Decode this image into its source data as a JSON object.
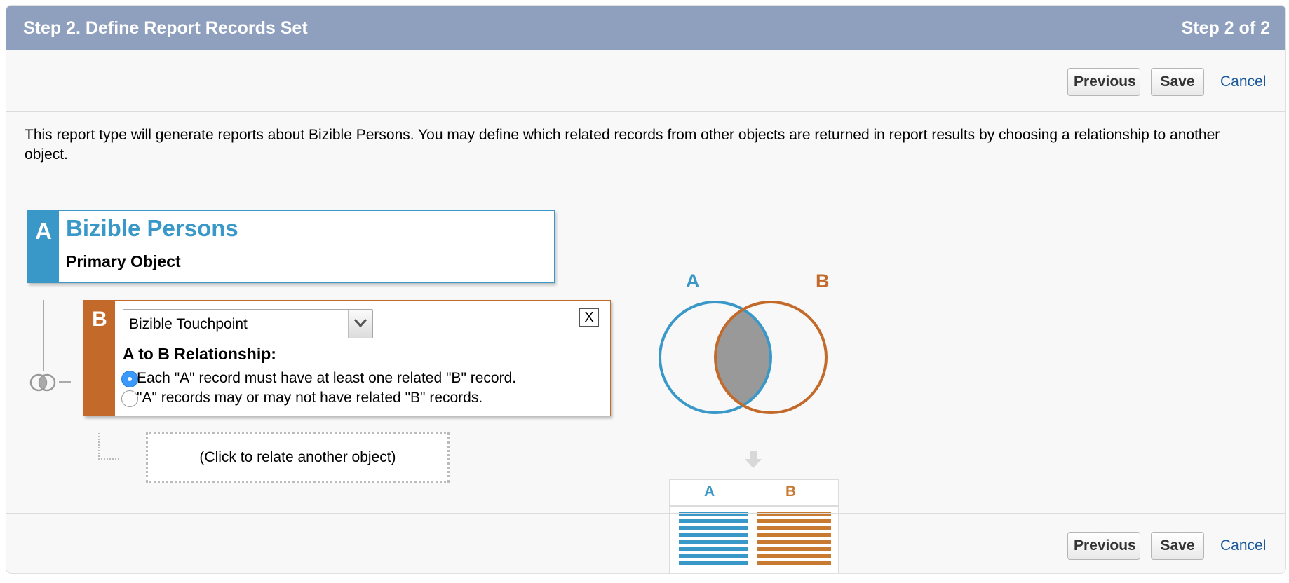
{
  "header": {
    "title": "Step 2. Define Report Records Set",
    "step": "Step 2 of 2"
  },
  "buttons": {
    "previous": "Previous",
    "save": "Save",
    "cancel": "Cancel"
  },
  "intro_text": "This report type will generate reports about Bizible Persons. You may define which related records from other objects are returned in report results by choosing a relationship to another object.",
  "object_a": {
    "tag": "A",
    "name": "Bizible Persons",
    "subtitle": "Primary Object"
  },
  "object_b": {
    "tag": "B",
    "selected": "Bizible Touchpoint",
    "close_label": "X",
    "relationship_label": "A to B Relationship:",
    "options": [
      {
        "label": "Each \"A\" record must have at least one related \"B\" record.",
        "selected": true
      },
      {
        "label": "\"A\" records may or may not have related \"B\" records.",
        "selected": false
      }
    ]
  },
  "relate_another": "(Click to relate another object)",
  "illustration": {
    "venn_a": "A",
    "venn_b": "B",
    "table_a": "A",
    "table_b": "B"
  },
  "colors": {
    "header_bg": "#8f9fbe",
    "object_a": "#3a98c8",
    "object_b": "#c3692a",
    "link": "#1a5a9c"
  },
  "icons": [
    "join-icon",
    "chevron-down-icon",
    "close-icon",
    "down-arrow-icon"
  ]
}
